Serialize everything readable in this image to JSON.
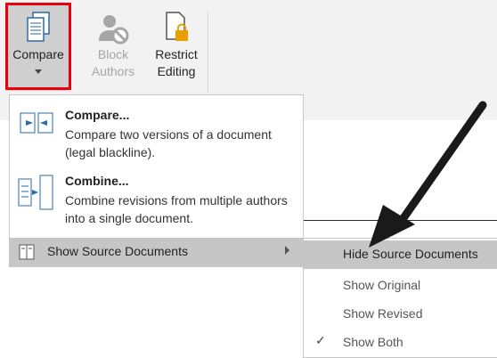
{
  "ribbon": {
    "compare_label": "Compare",
    "block_label_1": "Block",
    "block_label_2": "Authors",
    "restrict_label_1": "Restrict",
    "restrict_label_2": "Editing"
  },
  "menu": {
    "compare": {
      "title": "Compare...",
      "desc": "Compare two versions of a document (legal blackline)."
    },
    "combine": {
      "title": "Combine...",
      "desc": "Combine revisions from multiple authors into a single document."
    },
    "show_source": "Show Source Documents"
  },
  "submenu": {
    "items": [
      "Hide Source Documents",
      "Show Original",
      "Show Revised",
      "Show Both"
    ],
    "checked": "Show Both",
    "highlighted": "Hide Source Documents"
  },
  "colors": {
    "highlight_outline": "#e8000b",
    "arrow": "#1a1a1a"
  }
}
